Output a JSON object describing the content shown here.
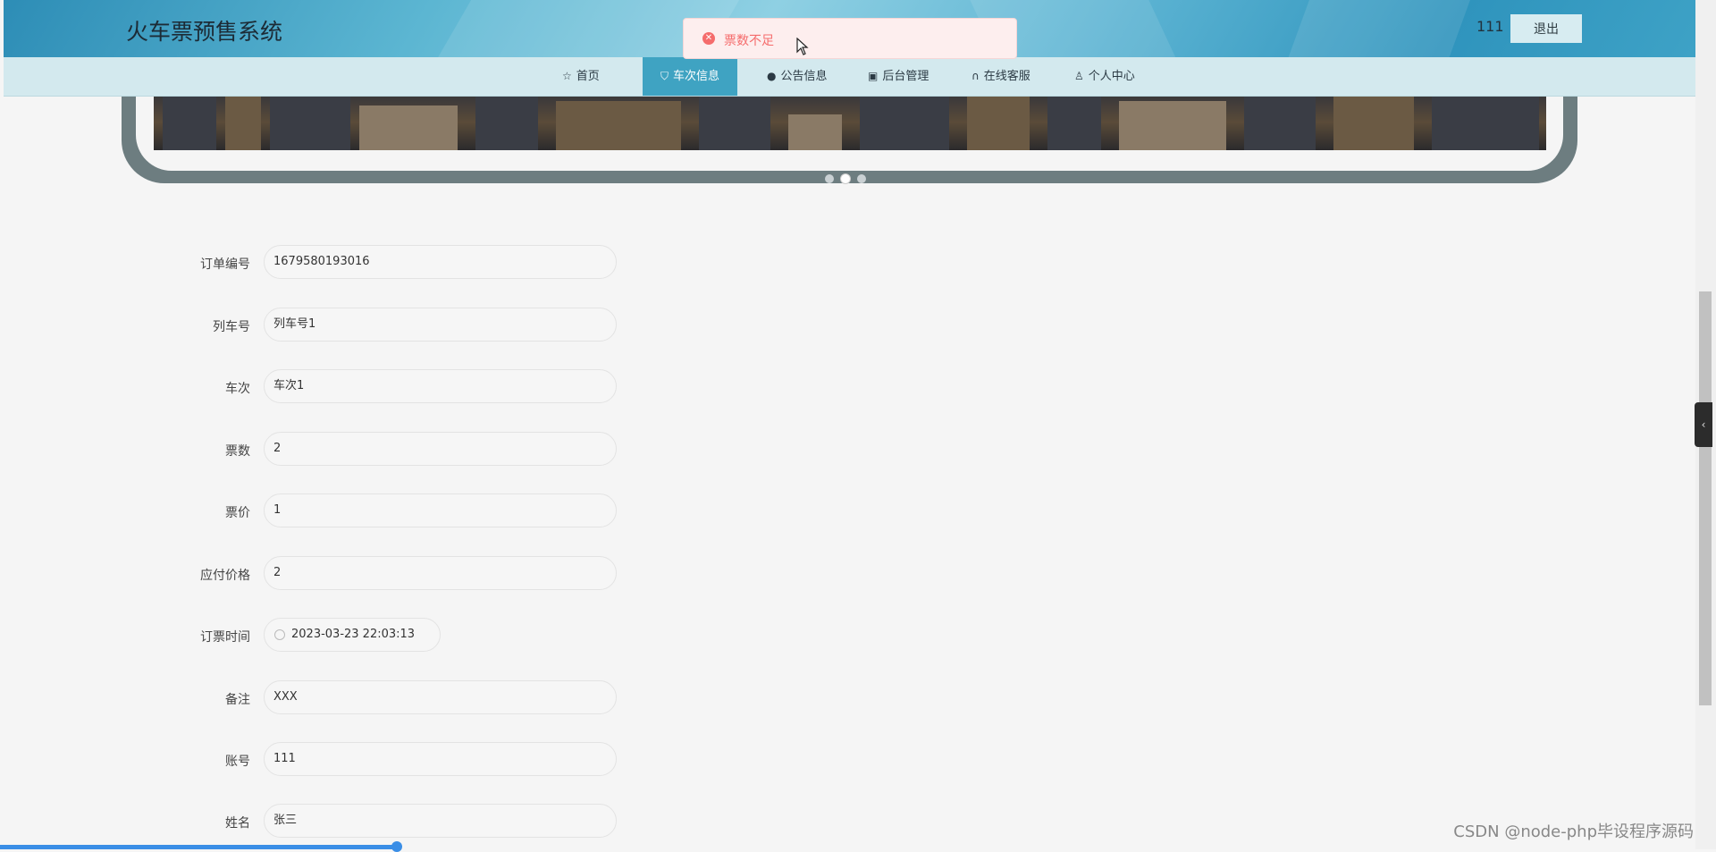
{
  "header": {
    "site_title": "火车票预售系统",
    "user_name": "111",
    "logout_label": "退出"
  },
  "nav": {
    "items": [
      {
        "label": "首页",
        "icon": "star-icon"
      },
      {
        "label": "车次信息",
        "icon": "bag-icon",
        "active": true
      },
      {
        "label": "公告信息",
        "icon": "info-icon"
      },
      {
        "label": "后台管理",
        "icon": "box-icon"
      },
      {
        "label": "在线客服",
        "icon": "headset-icon"
      },
      {
        "label": "个人中心",
        "icon": "user-icon"
      }
    ]
  },
  "toast": {
    "type": "error",
    "message": "票数不足"
  },
  "carousel": {
    "slides": 3,
    "active_index": 1
  },
  "form": {
    "fields": [
      {
        "label": "订单编号",
        "value": "1679580193016"
      },
      {
        "label": "列车号",
        "value": "列车号1"
      },
      {
        "label": "车次",
        "value": "车次1"
      },
      {
        "label": "票数",
        "value": "2"
      },
      {
        "label": "票价",
        "value": "1"
      },
      {
        "label": "应付价格",
        "value": "2"
      },
      {
        "label": "订票时间",
        "value": "2023-03-23 22:03:13"
      },
      {
        "label": "备注",
        "value": "XXX"
      },
      {
        "label": "账号",
        "value": "111"
      },
      {
        "label": "姓名",
        "value": "张三"
      }
    ]
  },
  "watermark": "CSDN @node-php毕设程序源码",
  "colors": {
    "accent": "#3fa3c2",
    "error": "#f56c6c"
  }
}
